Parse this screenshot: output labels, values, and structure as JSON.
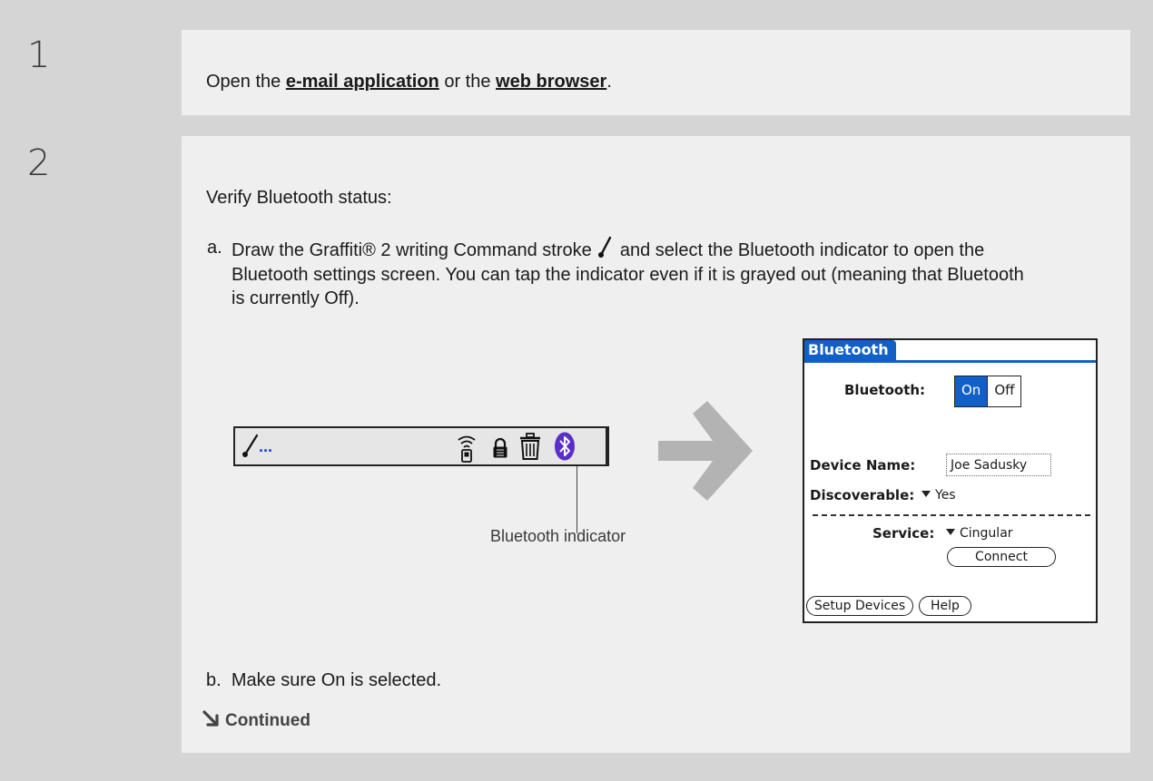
{
  "step1": {
    "number": "1",
    "prefix": "Open the ",
    "link1": "e-mail application",
    "middle": " or the ",
    "link2": "web browser",
    "suffix": "."
  },
  "step2": {
    "number": "2",
    "intro": "Verify Bluetooth status:",
    "a_label": "a.",
    "a_text_1": "Draw the Graffiti® 2 writing Command stroke",
    "a_text_2": " and select the Bluetooth indicator to open the Bluetooth settings screen. You can tap the indicator even if it is grayed out (meaning that Bluetooth is currently Off).",
    "status_bar": {
      "dots": "...",
      "icons": [
        "command-stroke-icon",
        "wireless-icon",
        "lock-icon",
        "trash-icon",
        "bluetooth-icon"
      ]
    },
    "callout": "Bluetooth indicator",
    "b_label": "b.",
    "b_text": "Make sure On is selected.",
    "continued": "Continued"
  },
  "dialog": {
    "title": "Bluetooth",
    "bluetooth_label": "Bluetooth:",
    "on": "On",
    "off": "Off",
    "device_name_label": "Device Name:",
    "device_name_value": "Joe Sadusky",
    "discoverable_label": "Discoverable:",
    "discoverable_value": "Yes",
    "service_label": "Service:",
    "service_value": "Cingular",
    "connect_button": "Connect",
    "setup_button": "Setup Devices",
    "help_button": "Help"
  },
  "colors": {
    "background": "#d5d5d5",
    "panel": "#efefef",
    "palm_blue": "#1060c8",
    "bluetooth_purple": "#5a2fc8",
    "arrow_gray": "#b3b3b3"
  }
}
